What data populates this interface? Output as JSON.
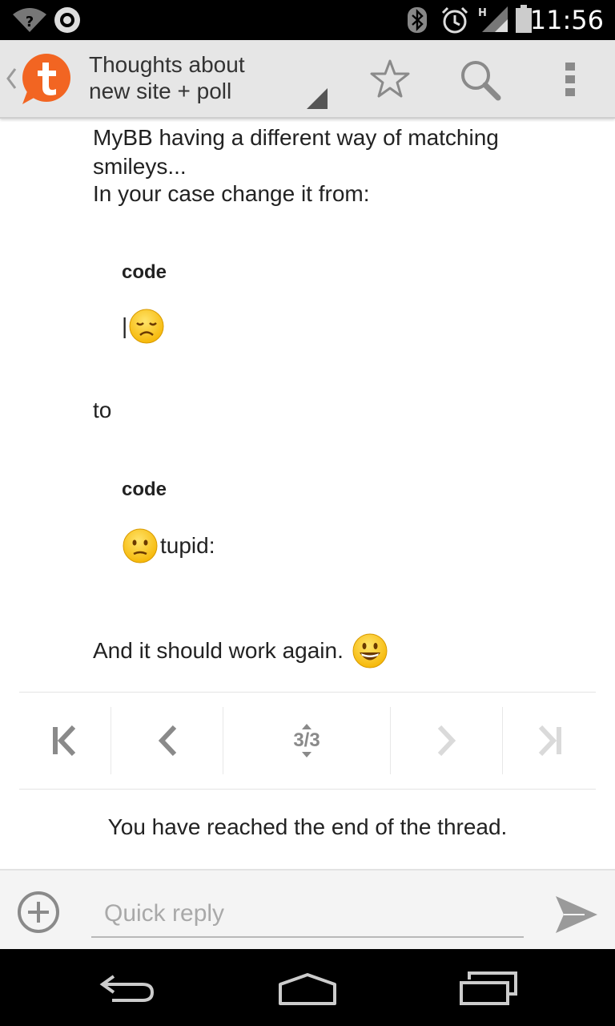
{
  "status_bar": {
    "time": "11:56",
    "icons": [
      "wifi-question-icon",
      "sync-icon",
      "bluetooth-icon",
      "alarm-icon",
      "hspa-signal-icon",
      "battery-icon"
    ]
  },
  "action_bar": {
    "title": "Thoughts about new site + poll",
    "title_line1": "Thoughts about",
    "title_line2": "new site + poll",
    "actions": [
      "star-icon",
      "search-icon",
      "overflow-menu-icon"
    ],
    "logo_color": "#f26522"
  },
  "post": {
    "line1": "MyBB having a different way of matching",
    "line2": "smileys...",
    "line3": "In your case change it from:",
    "code1_label": "code",
    "code1_text": "|",
    "to_text": "to",
    "code2_label": "code",
    "code2_text": "tupid:",
    "closing": "And it should work again."
  },
  "pager": {
    "indicator": "3/3",
    "buttons": [
      "first-page",
      "previous-page",
      "page-indicator",
      "next-page",
      "last-page"
    ]
  },
  "end_message": "You have reached the end of the thread.",
  "quick_reply": {
    "placeholder": "Quick reply"
  },
  "colors": {
    "accent": "#f26522",
    "actionbar_bg": "#e6e6e6",
    "text": "#222222",
    "muted_icon": "#8a8a8a"
  }
}
